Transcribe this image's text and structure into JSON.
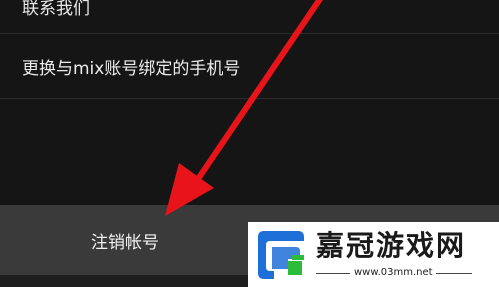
{
  "menu": {
    "items": [
      {
        "label": "联系我们"
      },
      {
        "label": "更换与mix账号绑定的手机号"
      }
    ],
    "cancel_label": "注销帐号"
  },
  "watermark": {
    "title": "嘉冠游戏网",
    "url": "www.03mm.net"
  },
  "colors": {
    "background": "#151515",
    "button_background": "#3a3a3a",
    "arrow": "#e8141a"
  },
  "icons": [
    "red-arrow-annotation",
    "watermark-logo-icon"
  ]
}
